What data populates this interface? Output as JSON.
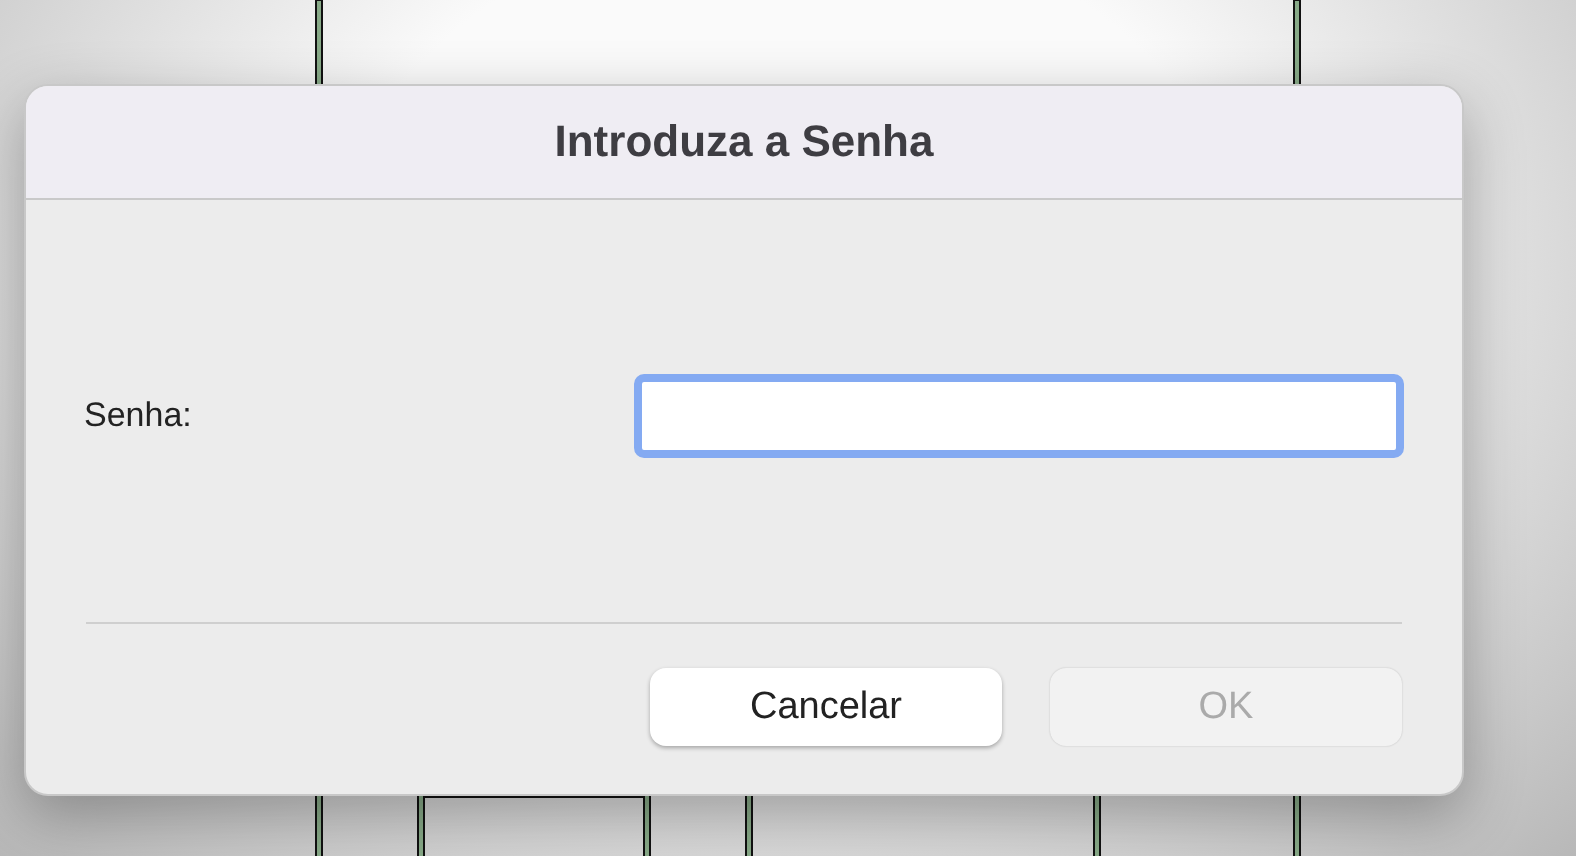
{
  "dialog": {
    "title": "Introduza a Senha",
    "field": {
      "label": "Senha:",
      "focused": true
    },
    "buttons": [
      {
        "label": "Cancelar",
        "disabled": false
      },
      {
        "label": "OK",
        "disabled": true
      }
    ]
  }
}
